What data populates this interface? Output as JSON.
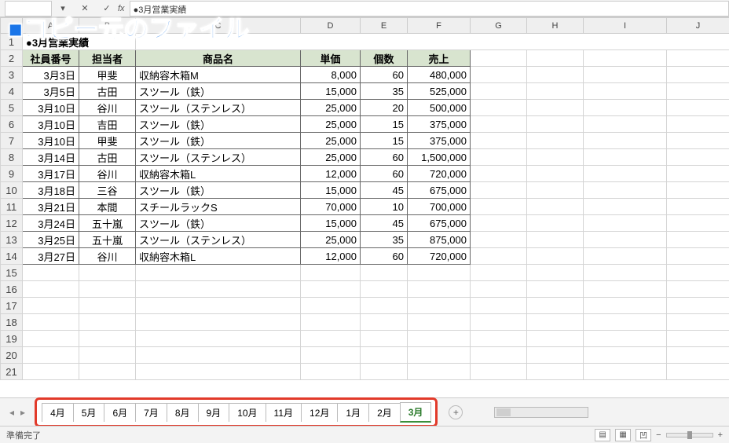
{
  "overlay_title": "■コピー元のファイル",
  "formula_bar_value": "●3月営業実績",
  "fx_label": "fx",
  "title_cell": "●3月営業実績",
  "header_row": {
    "emp_no": "社員番号",
    "rep": "担当者",
    "product": "商品名",
    "price": "単価",
    "qty": "個数",
    "sales": "売上"
  },
  "rows": [
    {
      "date": "3月3日",
      "rep": "甲斐",
      "product": "収納容木箱M",
      "price": "8,000",
      "qty": "60",
      "sales": "480,000"
    },
    {
      "date": "3月5日",
      "rep": "古田",
      "product": "スツール（鉄）",
      "price": "15,000",
      "qty": "35",
      "sales": "525,000"
    },
    {
      "date": "3月10日",
      "rep": "谷川",
      "product": "スツール（ステンレス）",
      "price": "25,000",
      "qty": "20",
      "sales": "500,000"
    },
    {
      "date": "3月10日",
      "rep": "吉田",
      "product": "スツール（鉄）",
      "price": "25,000",
      "qty": "15",
      "sales": "375,000"
    },
    {
      "date": "3月10日",
      "rep": "甲斐",
      "product": "スツール（鉄）",
      "price": "25,000",
      "qty": "15",
      "sales": "375,000"
    },
    {
      "date": "3月14日",
      "rep": "古田",
      "product": "スツール（ステンレス）",
      "price": "25,000",
      "qty": "60",
      "sales": "1,500,000"
    },
    {
      "date": "3月17日",
      "rep": "谷川",
      "product": "収納容木箱L",
      "price": "12,000",
      "qty": "60",
      "sales": "720,000"
    },
    {
      "date": "3月18日",
      "rep": "三谷",
      "product": "スツール（鉄）",
      "price": "15,000",
      "qty": "45",
      "sales": "675,000"
    },
    {
      "date": "3月21日",
      "rep": "本間",
      "product": "スチールラックS",
      "price": "70,000",
      "qty": "10",
      "sales": "700,000"
    },
    {
      "date": "3月24日",
      "rep": "五十嵐",
      "product": "スツール（鉄）",
      "price": "15,000",
      "qty": "45",
      "sales": "675,000"
    },
    {
      "date": "3月25日",
      "rep": "五十嵐",
      "product": "スツール（ステンレス）",
      "price": "25,000",
      "qty": "35",
      "sales": "875,000"
    },
    {
      "date": "3月27日",
      "rep": "谷川",
      "product": "収納容木箱L",
      "price": "12,000",
      "qty": "60",
      "sales": "720,000"
    }
  ],
  "columns": [
    "A",
    "B",
    "C",
    "D",
    "E",
    "F",
    "G",
    "H",
    "I",
    "J"
  ],
  "row_numbers": [
    "1",
    "2",
    "3",
    "4",
    "5",
    "6",
    "7",
    "8",
    "9",
    "10",
    "11",
    "12",
    "13",
    "14",
    "15",
    "16",
    "17",
    "18",
    "19",
    "20",
    "21"
  ],
  "tabs": [
    "4月",
    "5月",
    "6月",
    "7月",
    "8月",
    "9月",
    "10月",
    "11月",
    "12月",
    "1月",
    "2月",
    "3月"
  ],
  "active_tab": "3月",
  "status_text": "準備完了",
  "add_sheet_label": "+",
  "zoom_minus": "−",
  "zoom_plus": "+"
}
